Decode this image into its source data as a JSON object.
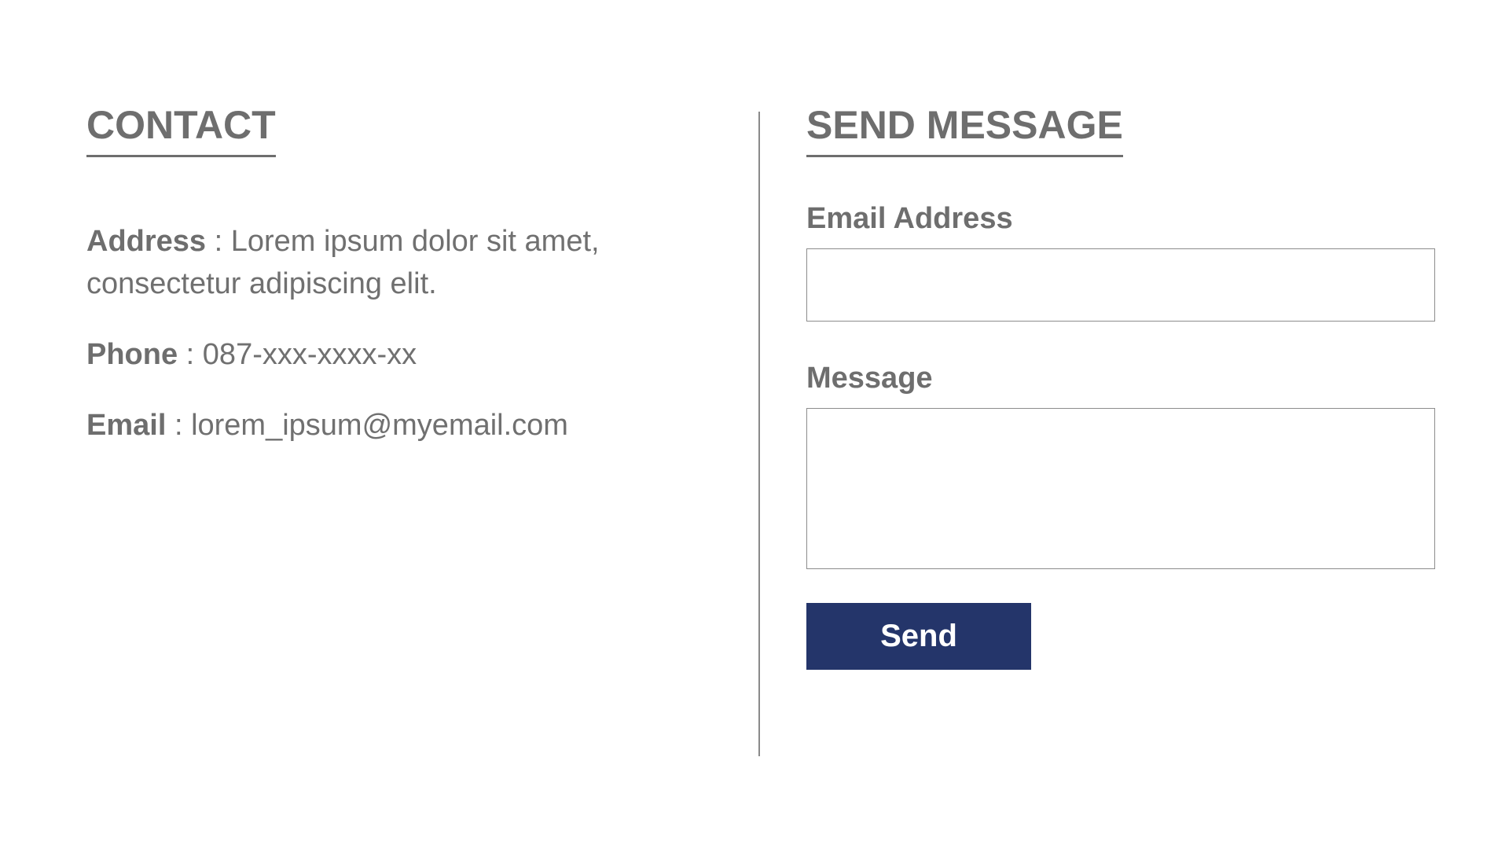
{
  "contact": {
    "title": "CONTACT",
    "address_label": "Address",
    "address_value": " : Lorem ipsum dolor sit amet, consectetur adipiscing elit.",
    "phone_label": "Phone",
    "phone_value": " : 087-xxx-xxxx-xx",
    "email_label": "Email",
    "email_value": " : lorem_ipsum@myemail.com"
  },
  "form": {
    "title": "SEND MESSAGE",
    "email_field_label": "Email Address",
    "email_field_value": "",
    "message_field_label": "Message",
    "message_field_value": "",
    "send_label": "Send"
  },
  "colors": {
    "text": "#707070",
    "button_bg": "#24356a",
    "button_text": "#ffffff",
    "input_border": "#8c8c8c"
  }
}
